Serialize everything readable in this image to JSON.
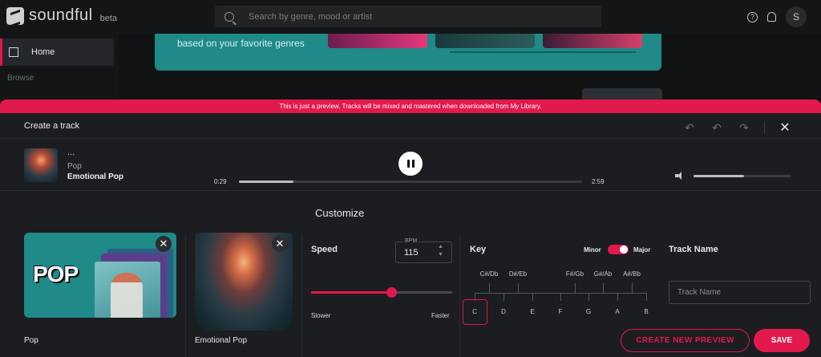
{
  "app": {
    "logo_text": "soundful",
    "logo_beta": "beta"
  },
  "search": {
    "placeholder": "Search by genre, mood or artist"
  },
  "header": {
    "avatar_initial": "S",
    "help_glyph": "?"
  },
  "sidebar": {
    "home_label": "Home",
    "browse_label": "Browse"
  },
  "banner": {
    "text": "based on your favorite genres"
  },
  "preview_notice": "This is just a preview. Tracks will be mixed and mastered when downloaded from My Library.",
  "panel": {
    "title": "Create a track",
    "icons": [
      "undo-all-icon",
      "undo-icon",
      "redo-icon",
      "close-icon"
    ],
    "glyphs": {
      "undo_all": "↶",
      "undo": "↶",
      "redo": "↷",
      "close": "✕"
    }
  },
  "player": {
    "title": "...",
    "genre": "Pop",
    "mood": "Emotional Pop",
    "current_time": "0:29",
    "total_time": "2:59",
    "progress": 0.16,
    "volume": 0.52
  },
  "customize": {
    "title": "Customize",
    "cards": [
      {
        "label": "Pop",
        "art_text": "POP"
      },
      {
        "label": "Emotional Pop"
      }
    ],
    "close_glyph": "✕",
    "speed": {
      "label": "Speed",
      "bpm_label": "BPM",
      "bpm_value": "115",
      "slower": "Slower",
      "faster": "Faster",
      "level": 0.57
    },
    "key": {
      "label": "Key",
      "minor": "Minor",
      "major": "Major",
      "mode": "Major",
      "sharps": [
        "C#/Db",
        "D#/Eb",
        "F#/Gb",
        "G#/Ab",
        "A#/Bb"
      ],
      "naturals": [
        "C",
        "D",
        "E",
        "F",
        "G",
        "A",
        "B"
      ],
      "selected": "C"
    },
    "track_name": {
      "label": "Track Name",
      "placeholder": "Track Name",
      "value": ""
    },
    "buttons": {
      "create_preview": "CREATE NEW PREVIEW",
      "save": "SAVE"
    }
  },
  "colors": {
    "accent": "#e2194c",
    "teal": "#1f8a87",
    "panel": "#1c1d20",
    "background": "#111214"
  }
}
